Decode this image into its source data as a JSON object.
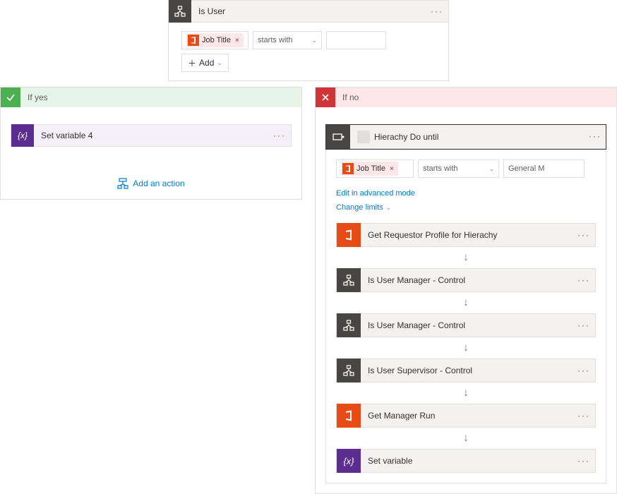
{
  "top": {
    "title": "Is User",
    "token_label": "Job Title",
    "operator": "starts with",
    "value": "",
    "add_label": "Add"
  },
  "yes_branch": {
    "label": "If yes",
    "action_title": "Set variable 4",
    "add_action": "Add an action"
  },
  "no_branch": {
    "label": "If no",
    "do_until_title": "Hierachy Do until",
    "token_label": "Job Title",
    "operator": "starts with",
    "value": "General M",
    "edit_mode": "Edit in advanced mode",
    "change_limits": "Change limits",
    "steps": {
      "s1": "Get Requestor Profile for Hierachy",
      "s2": "Is User          Manager - Control",
      "s3": "Is User Manager - Control",
      "s4": "Is User Supervisor - Control",
      "s5": "Get Manager        Run",
      "s6": "Set variable"
    }
  }
}
